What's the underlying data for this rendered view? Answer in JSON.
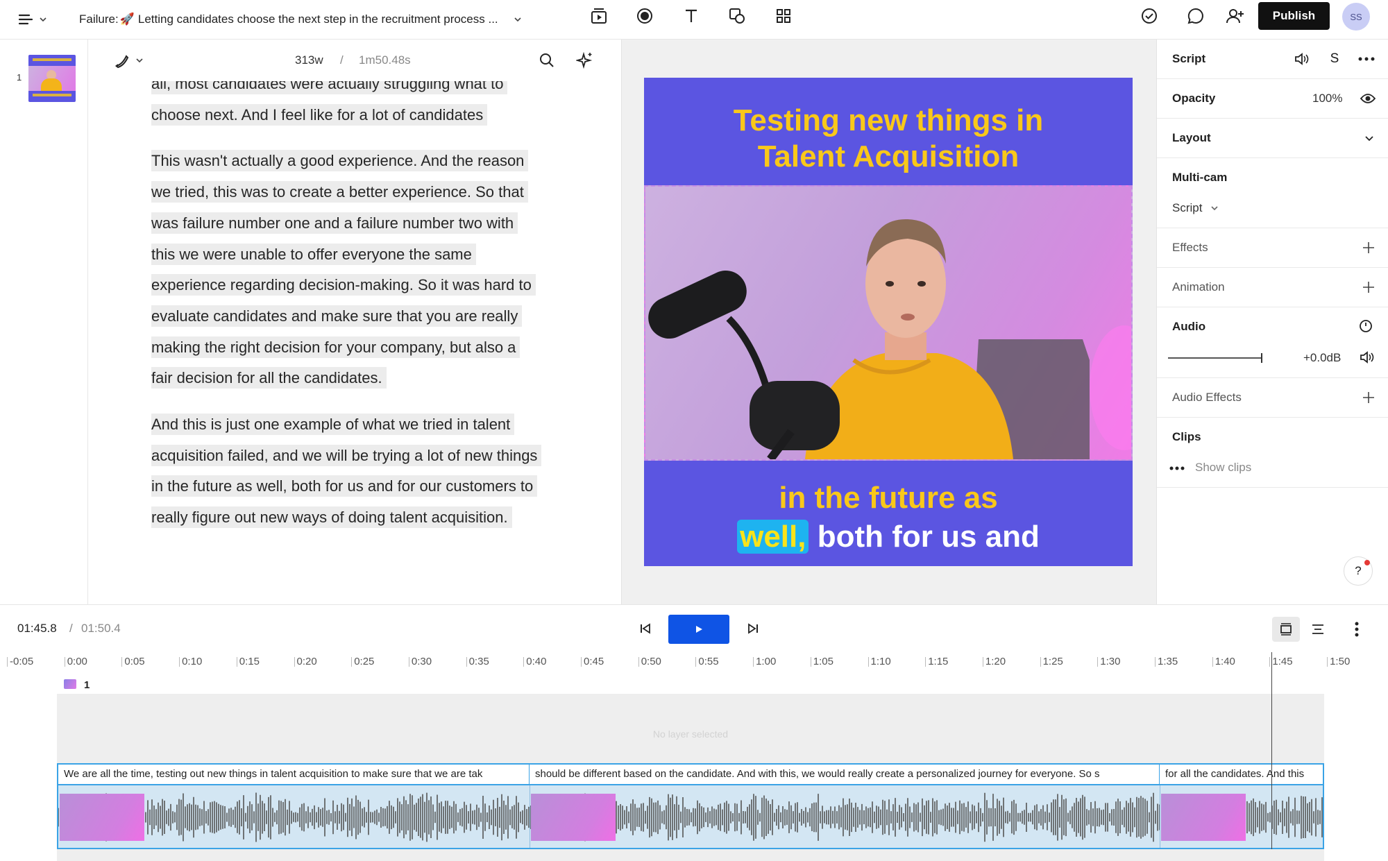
{
  "topbar": {
    "title_prefix": "Failure: ",
    "title_emoji": "🚀",
    "title_text": "Letting candidates choose the next step in the recruitment process ...",
    "publish_label": "Publish",
    "avatar_initials": "SS"
  },
  "scenes": [
    {
      "number": "1"
    }
  ],
  "editor": {
    "word_count": "313w",
    "separator": "/",
    "duration": "1m50.48s",
    "paragraphs": [
      "all, most candidates were actually struggling what to choose next. And I feel like for a lot of candidates",
      "This wasn't actually a good experience. And the reason we tried, this was to create a better experience. So that was failure number one and a failure number two with this we were unable to offer everyone the same experience regarding decision-making. So it was hard to evaluate candidates and make sure that you are really making the right decision for your company, but also a fair decision for all the candidates.",
      "And this is just one example of what we tried in talent acquisition failed, and we will be trying a lot of new things in the future as well, both for us and for our customers to really figure out new ways of doing talent acquisition."
    ]
  },
  "canvas": {
    "caption_top_line1": "Testing new things in",
    "caption_top_line2": "Talent Acquisition",
    "caption_bottom_line1": "in the future as",
    "caption_bottom_highlight": "well,",
    "caption_bottom_rest": "both for us and",
    "colors": {
      "background": "#5b55e1",
      "caption_yellow": "#f9c81a",
      "highlight": "#1eb3f0"
    }
  },
  "properties": {
    "script_label": "Script",
    "opacity_label": "Opacity",
    "opacity_value": "100%",
    "layout_label": "Layout",
    "multicam_label": "Multi-cam",
    "multicam_select": "Script",
    "effects_label": "Effects",
    "animation_label": "Animation",
    "audio_label": "Audio",
    "audio_value": "+0.0dB",
    "audio_effects_label": "Audio Effects",
    "clips_label": "Clips",
    "show_clips_label": "Show clips",
    "help_label": "?"
  },
  "transport": {
    "current_time": "01:45.8",
    "separator": "/",
    "total_time": "01:50.4"
  },
  "timeline": {
    "ticks": [
      "-0:05",
      "0:00",
      "0:05",
      "0:10",
      "0:15",
      "0:20",
      "0:25",
      "0:30",
      "0:35",
      "0:40",
      "0:45",
      "0:50",
      "0:55",
      "1:00",
      "1:05",
      "1:10",
      "1:15",
      "1:20",
      "1:25",
      "1:30",
      "1:35",
      "1:40",
      "1:45",
      "1:50"
    ],
    "scene_label": "1",
    "empty_label": "No layer selected",
    "captions": [
      "We are all the time, testing out new things in talent acquisition to make sure that we are tak",
      "should be different based on the candidate. And with this, we would really create a personalized journey for everyone. So s",
      "for all the candidates. And this"
    ]
  }
}
